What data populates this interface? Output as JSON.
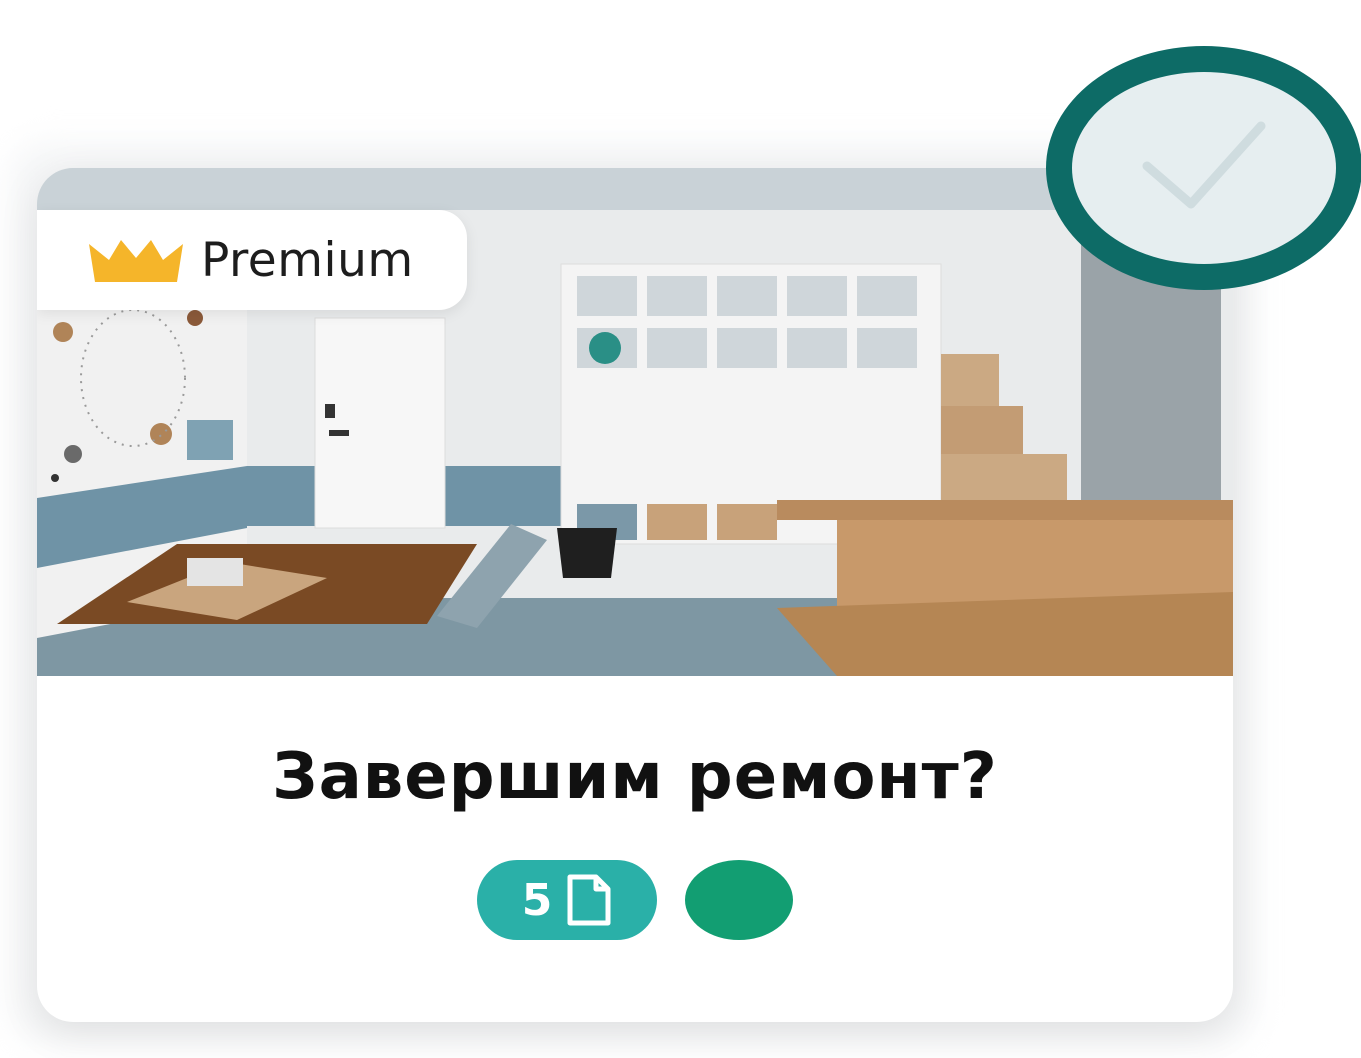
{
  "card": {
    "premium_label": "Premium",
    "title": "Завершим ремонт?",
    "pages_count": "5",
    "selected": true
  },
  "icons": {
    "crown": "crown-icon",
    "document": "document-icon",
    "check": "check-icon"
  },
  "colors": {
    "crown": "#f5b52a",
    "pages_chip": "#2ab0a8",
    "status_dot": "#129e72",
    "check_ring": "#0d6b66"
  }
}
